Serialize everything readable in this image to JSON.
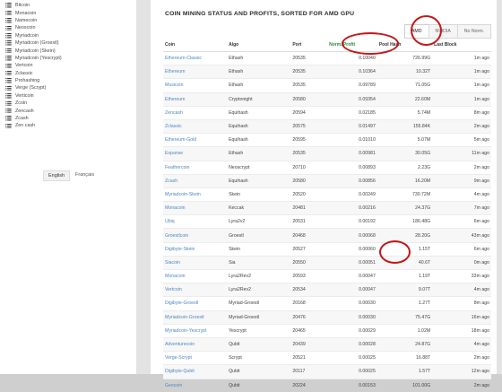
{
  "sidebar": {
    "items": [
      "Bitcoin",
      "Monacoin",
      "Namecoin",
      "Neoscoin",
      "Myriadcoin",
      "Myriadcoin (Groestl)",
      "Myriadcoin (Skein)",
      "Myriadcoin (Yescrypt)",
      "Vertcoin",
      "Zclassic",
      "Prohashing",
      "Verge (Scrypt)",
      "Verticoin",
      "Zcoin",
      "Zencash",
      "Zcash",
      "Zen cash"
    ],
    "languages": [
      "English",
      "Français"
    ]
  },
  "main": {
    "title": "COIN MINING STATUS AND PROFITS, SORTED FOR AMD GPU",
    "filters": [
      "AMD",
      "NVIDIA",
      "No Norm."
    ],
    "columns": [
      "Coin",
      "Algo",
      "Port",
      "Norm. Profit",
      "Pool Hash",
      "Last Block"
    ],
    "rows": [
      [
        "Ethereum-Classic",
        "Ethash",
        "20535",
        "0.10040",
        "726.99G",
        "1m ago"
      ],
      [
        "Ethereum",
        "Ethash",
        "20535",
        "0.10364",
        "10.32T",
        "1m ago"
      ],
      [
        "Musicoin",
        "Ethash",
        "20535",
        "0.09789",
        "71.05G",
        "1m ago"
      ],
      [
        "Ethereum",
        "Cryptonight",
        "20580",
        "0.09354",
        "22.60M",
        "1m ago"
      ],
      [
        "Zencash",
        "Equihash",
        "20594",
        "0.02185",
        "5.74M",
        "8m ago"
      ],
      [
        "Zclassic",
        "Equihash",
        "20575",
        "0.01497",
        "155.84K",
        "2m ago"
      ],
      [
        "Ethereum-Gold",
        "Equihash",
        "20595",
        "0.01010",
        "5.07M",
        "5m ago"
      ],
      [
        "Expanse",
        "Ethash",
        "20535",
        "0.00981",
        "30.05G",
        "11m ago"
      ],
      [
        "Feathercoin",
        "Neoscrypt",
        "20710",
        "0.00893",
        "2.23G",
        "2m ago"
      ],
      [
        "Zcash",
        "Equihash",
        "20580",
        "0.00856",
        "16.20M",
        "9m ago"
      ],
      [
        "Myriadcoin-Skein",
        "Skein",
        "20520",
        "0.00249",
        "730.72M",
        "4m ago"
      ],
      [
        "Monacoin",
        "Keccak",
        "20481",
        "0.00216",
        "24.37G",
        "7m ago"
      ],
      [
        "Ubiq",
        "Lyra2v2",
        "20531",
        "0.00192",
        "186.48G",
        "6m ago"
      ],
      [
        "Groestlcoin",
        "Groestl",
        "20468",
        "0.00068",
        "28.20G",
        "43m ago"
      ],
      [
        "Digibyte-Skein",
        "Skein",
        "20527",
        "0.00060",
        "1.15T",
        "6m ago"
      ],
      [
        "Siacoin",
        "Sia",
        "20550",
        "0.00051",
        "40.6T",
        "0m ago"
      ],
      [
        "Monacoin",
        "Lyra2Rev2",
        "20593",
        "0.00047",
        "1.19T",
        "33m ago"
      ],
      [
        "Vertcoin",
        "Lyra2Rev2",
        "20534",
        "0.00047",
        "9.07T",
        "4m ago"
      ],
      [
        "Digibyte-Groestl",
        "Myriad-Groestl",
        "20168",
        "0.00030",
        "1.27T",
        "8m ago"
      ],
      [
        "Myriadcoin-Groestl",
        "Myriad-Groestl",
        "20476",
        "0.00030",
        "75.47G",
        "16m ago"
      ],
      [
        "Myriadcoin-Yescrypt",
        "Yescrypt",
        "20465",
        "0.00029",
        "1.02M",
        "18m ago"
      ],
      [
        "Adventurecoin",
        "Qubit",
        "20439",
        "0.00028",
        "24.87G",
        "4m ago"
      ],
      [
        "Verge-Scrypt",
        "Scrypt",
        "20521",
        "0.00025",
        "16.88T",
        "2m ago"
      ],
      [
        "Digibyte-Qubit",
        "Qubit",
        "20117",
        "0.00025",
        "1.57T",
        "12m ago"
      ],
      [
        "Geocoin",
        "Qubit",
        "20224",
        "0.00153",
        "101.00G",
        "2m ago"
      ]
    ]
  },
  "colors": {
    "link": "#4d88c4",
    "sorted_header": "#2d8a3a",
    "annotation": "#c41717"
  }
}
